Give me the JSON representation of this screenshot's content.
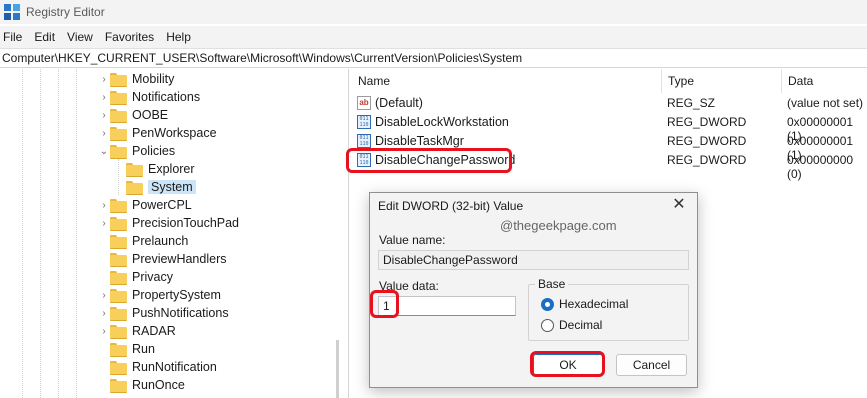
{
  "window": {
    "title": "Registry Editor"
  },
  "menu": [
    "File",
    "Edit",
    "View",
    "Favorites",
    "Help"
  ],
  "address": "Computer\\HKEY_CURRENT_USER\\Software\\Microsoft\\Windows\\CurrentVersion\\Policies\\System",
  "tree": {
    "items": [
      {
        "label": "Mobility",
        "expander": "›"
      },
      {
        "label": "Notifications",
        "expander": "›"
      },
      {
        "label": "OOBE",
        "expander": "›"
      },
      {
        "label": "PenWorkspace",
        "expander": "›"
      },
      {
        "label": "Policies",
        "expander": "⌄"
      },
      {
        "label": "Explorer",
        "expander": ""
      },
      {
        "label": "System",
        "expander": ""
      },
      {
        "label": "PowerCPL",
        "expander": "›"
      },
      {
        "label": "PrecisionTouchPad",
        "expander": "›"
      },
      {
        "label": "Prelaunch",
        "expander": ""
      },
      {
        "label": "PreviewHandlers",
        "expander": ""
      },
      {
        "label": "Privacy",
        "expander": ""
      },
      {
        "label": "PropertySystem",
        "expander": "›"
      },
      {
        "label": "PushNotifications",
        "expander": "›"
      },
      {
        "label": "RADAR",
        "expander": "›"
      },
      {
        "label": "Run",
        "expander": ""
      },
      {
        "label": "RunNotification",
        "expander": ""
      },
      {
        "label": "RunOnce",
        "expander": ""
      }
    ]
  },
  "values": {
    "headers": {
      "name": "Name",
      "type": "Type",
      "data": "Data"
    },
    "rows": [
      {
        "name": "(Default)",
        "type": "REG_SZ",
        "data": "(value not set)",
        "icon": "string-value-icon"
      },
      {
        "name": "DisableLockWorkstation",
        "type": "REG_DWORD",
        "data": "0x00000001 (1)",
        "icon": "dword-value-icon"
      },
      {
        "name": "DisableTaskMgr",
        "type": "REG_DWORD",
        "data": "0x00000001 (1)",
        "icon": "dword-value-icon"
      },
      {
        "name": "DisableChangePassword",
        "type": "REG_DWORD",
        "data": "0x00000000 (0)",
        "icon": "dword-value-icon"
      }
    ],
    "icon_glyph_string": "ab",
    "icon_glyph_binary": "011\n110"
  },
  "dialog": {
    "title": "Edit DWORD (32-bit) Value",
    "close_glyph": "✕",
    "watermark": "@thegeekpage.com",
    "value_name_label": "Value name:",
    "value_name": "DisableChangePassword",
    "value_data_label": "Value data:",
    "value_data": "1",
    "base_label": "Base",
    "radio_hex": "Hexadecimal",
    "radio_dec": "Decimal",
    "selected_base": "Hexadecimal",
    "ok_label": "OK",
    "cancel_label": "Cancel"
  },
  "colors": {
    "highlight": "#e8121f",
    "selection": "#cce4f7",
    "accent": "#1b6ec2",
    "folder": "#f7cf5a"
  }
}
